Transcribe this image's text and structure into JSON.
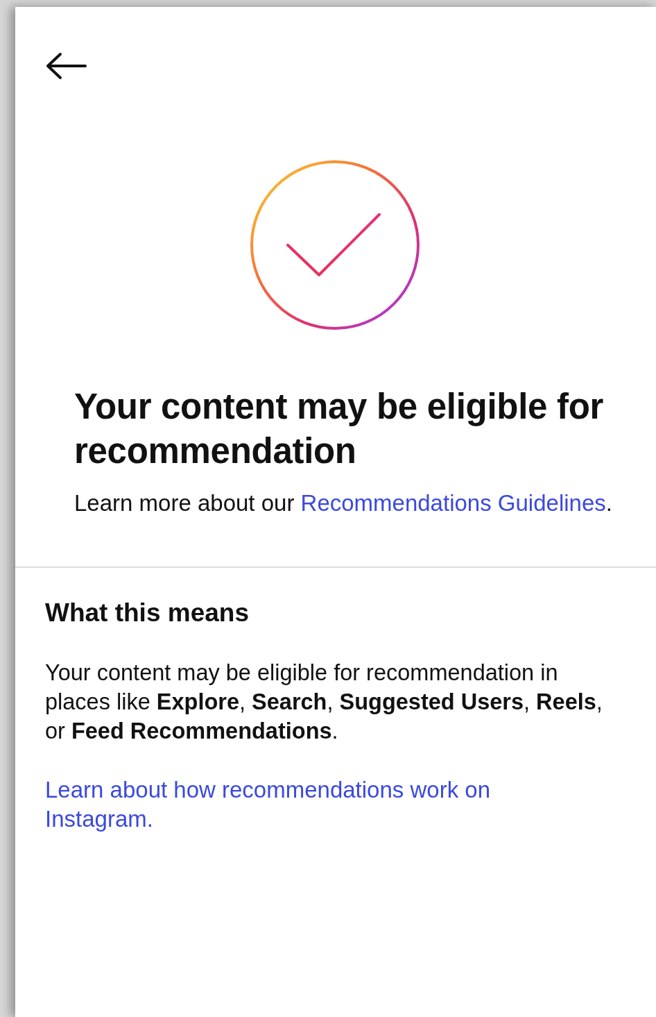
{
  "header": {
    "title": "Your content may be eligible for recommendation",
    "intro": "Learn more about our",
    "link": "Recommendations Guidelines",
    "after_link": "."
  },
  "section": {
    "heading": "What this means",
    "body": "Your content may be eligible for recommendation in places like **Explore**, **Search**, **Suggested Users**, **Reels**, or **Feed Recommendations**.",
    "link": "Learn about how recommendations work on Instagram."
  }
}
